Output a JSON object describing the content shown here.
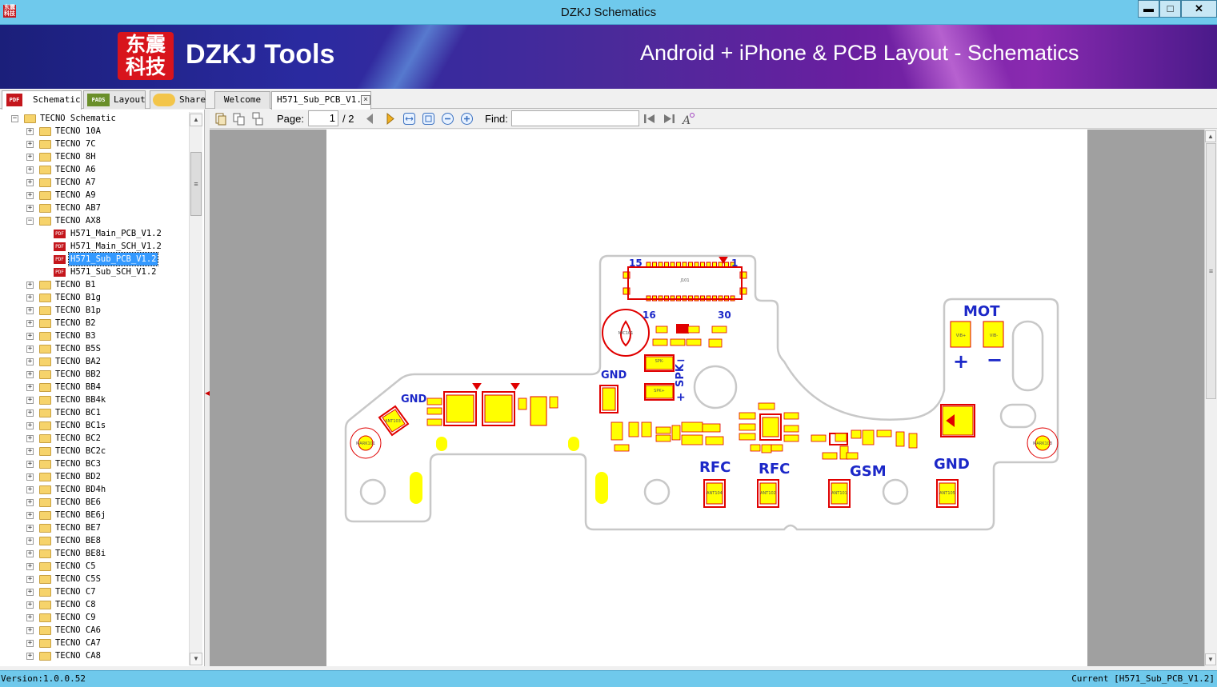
{
  "window": {
    "title": "DZKJ Schematics",
    "min": "▬",
    "max": "□",
    "close": "✕"
  },
  "banner": {
    "logo_line1": "东震",
    "logo_line2": "科技",
    "brand": "DZKJ Tools",
    "slogan": "Android + iPhone & PCB Layout - Schematics",
    "logo_color": "#d8141c"
  },
  "main_tabs": [
    {
      "label": "Schematic",
      "icon": "pdf-icon",
      "active": true
    },
    {
      "label": "Layout",
      "icon": "pads-icon"
    },
    {
      "label": "Share",
      "icon": "cloud-share-icon"
    }
  ],
  "tab_icons": {
    "pdf": "PDF",
    "pads": "PADS"
  },
  "doc_tabs": [
    {
      "label": "Welcome"
    },
    {
      "label": "H571_Sub_PCB_V1.2",
      "active": true
    }
  ],
  "toolbar": {
    "page_label": "Page:",
    "page_current": "1",
    "page_total": "/ 2",
    "find_label": "Find:"
  },
  "tree": {
    "root": "TECNO Schematic",
    "folders_before": [
      "TECNO 10A",
      "TECNO 7C",
      "TECNO 8H",
      "TECNO A6",
      "TECNO A7",
      "TECNO A9",
      "TECNO AB7"
    ],
    "expanded": "TECNO AX8",
    "files": [
      "H571_Main_PCB_V1.2",
      "H571_Main_SCH_V1.2",
      "H571_Sub_PCB_V1.2",
      "H571_Sub_SCH_V1.2"
    ],
    "selected_file": "H571_Sub_PCB_V1.2",
    "folders_after": [
      "TECNO B1",
      "TECNO B1g",
      "TECNO B1p",
      "TECNO B2",
      "TECNO B3",
      "TECNO B5S",
      "TECNO BA2",
      "TECNO BB2",
      "TECNO BB4",
      "TECNO BB4k",
      "TECNO BC1",
      "TECNO BC1s",
      "TECNO BC2",
      "TECNO BC2c",
      "TECNO BC3",
      "TECNO BD2",
      "TECNO BD4h",
      "TECNO BE6",
      "TECNO BE6j",
      "TECNO BE7",
      "TECNO BE8",
      "TECNO BE8i",
      "TECNO C5",
      "TECNO C5S",
      "TECNO C7",
      "TECNO C8",
      "TECNO C9",
      "TECNO CA6",
      "TECNO CA7",
      "TECNO CA8"
    ]
  },
  "pcb": {
    "labels": {
      "pin15": "15",
      "pin1": "1",
      "pin16": "16",
      "pin30": "30",
      "connector": "J101",
      "mot": "MOT",
      "plus": "+",
      "minus": "−",
      "spk": "SPK",
      "gnd_left": "GND",
      "gnd_mid": "GND",
      "gnd_right": "GND",
      "rfc1": "RFC",
      "rfc2": "RFC",
      "gsm": "GSM",
      "mark_left": "MARK101",
      "mark_right": "MARK103",
      "spk_minus": "SPK-",
      "spk_plus": "SPK+",
      "ant103": "ANT103",
      "ant104": "ANT104",
      "ant102": "ANT102",
      "ant101": "ANT101",
      "ant105": "ANT105",
      "vib_plus": "VIB+",
      "vib_minus": "VIB-",
      "mic": "MIC101",
      "spk_sign_minus": "−",
      "spk_sign_plus": "+"
    },
    "colors": {
      "outline": "#c8c8c8",
      "pad": "#ffff00",
      "silk": "#e00000",
      "text": "#1c28c8"
    }
  },
  "status": {
    "version": "Version:1.0.0.52",
    "current": "Current [H571_Sub_PCB_V1.2]"
  }
}
